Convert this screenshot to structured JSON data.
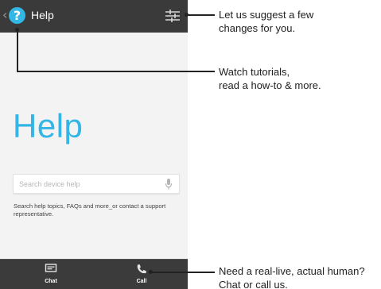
{
  "app": {
    "back_icon": "chevron-left-icon",
    "logo_icon": "help-question-icon",
    "logo_glyph": "?",
    "title": "Help",
    "settings_icon": "sliders-icon",
    "accent_color": "#33b5e5",
    "appbar_color": "#3a3a3a"
  },
  "main": {
    "heading": "Help",
    "search": {
      "placeholder": "Search device help",
      "mic_icon": "microphone-icon"
    },
    "helper_text": "Search help topics, FAQs and more_or contact a support representative."
  },
  "bottom_bar": {
    "items": [
      {
        "label": "Chat",
        "icon": "chat-icon"
      },
      {
        "label": "Call",
        "icon": "phone-icon"
      }
    ]
  },
  "callouts": [
    {
      "lines": [
        "Let us suggest a few",
        "changes for you."
      ]
    },
    {
      "lines": [
        "Watch tutorials,",
        "read a how-to & more."
      ]
    },
    {
      "lines": [
        "Need a real-live, actual human?",
        "Chat or call us."
      ]
    }
  ]
}
